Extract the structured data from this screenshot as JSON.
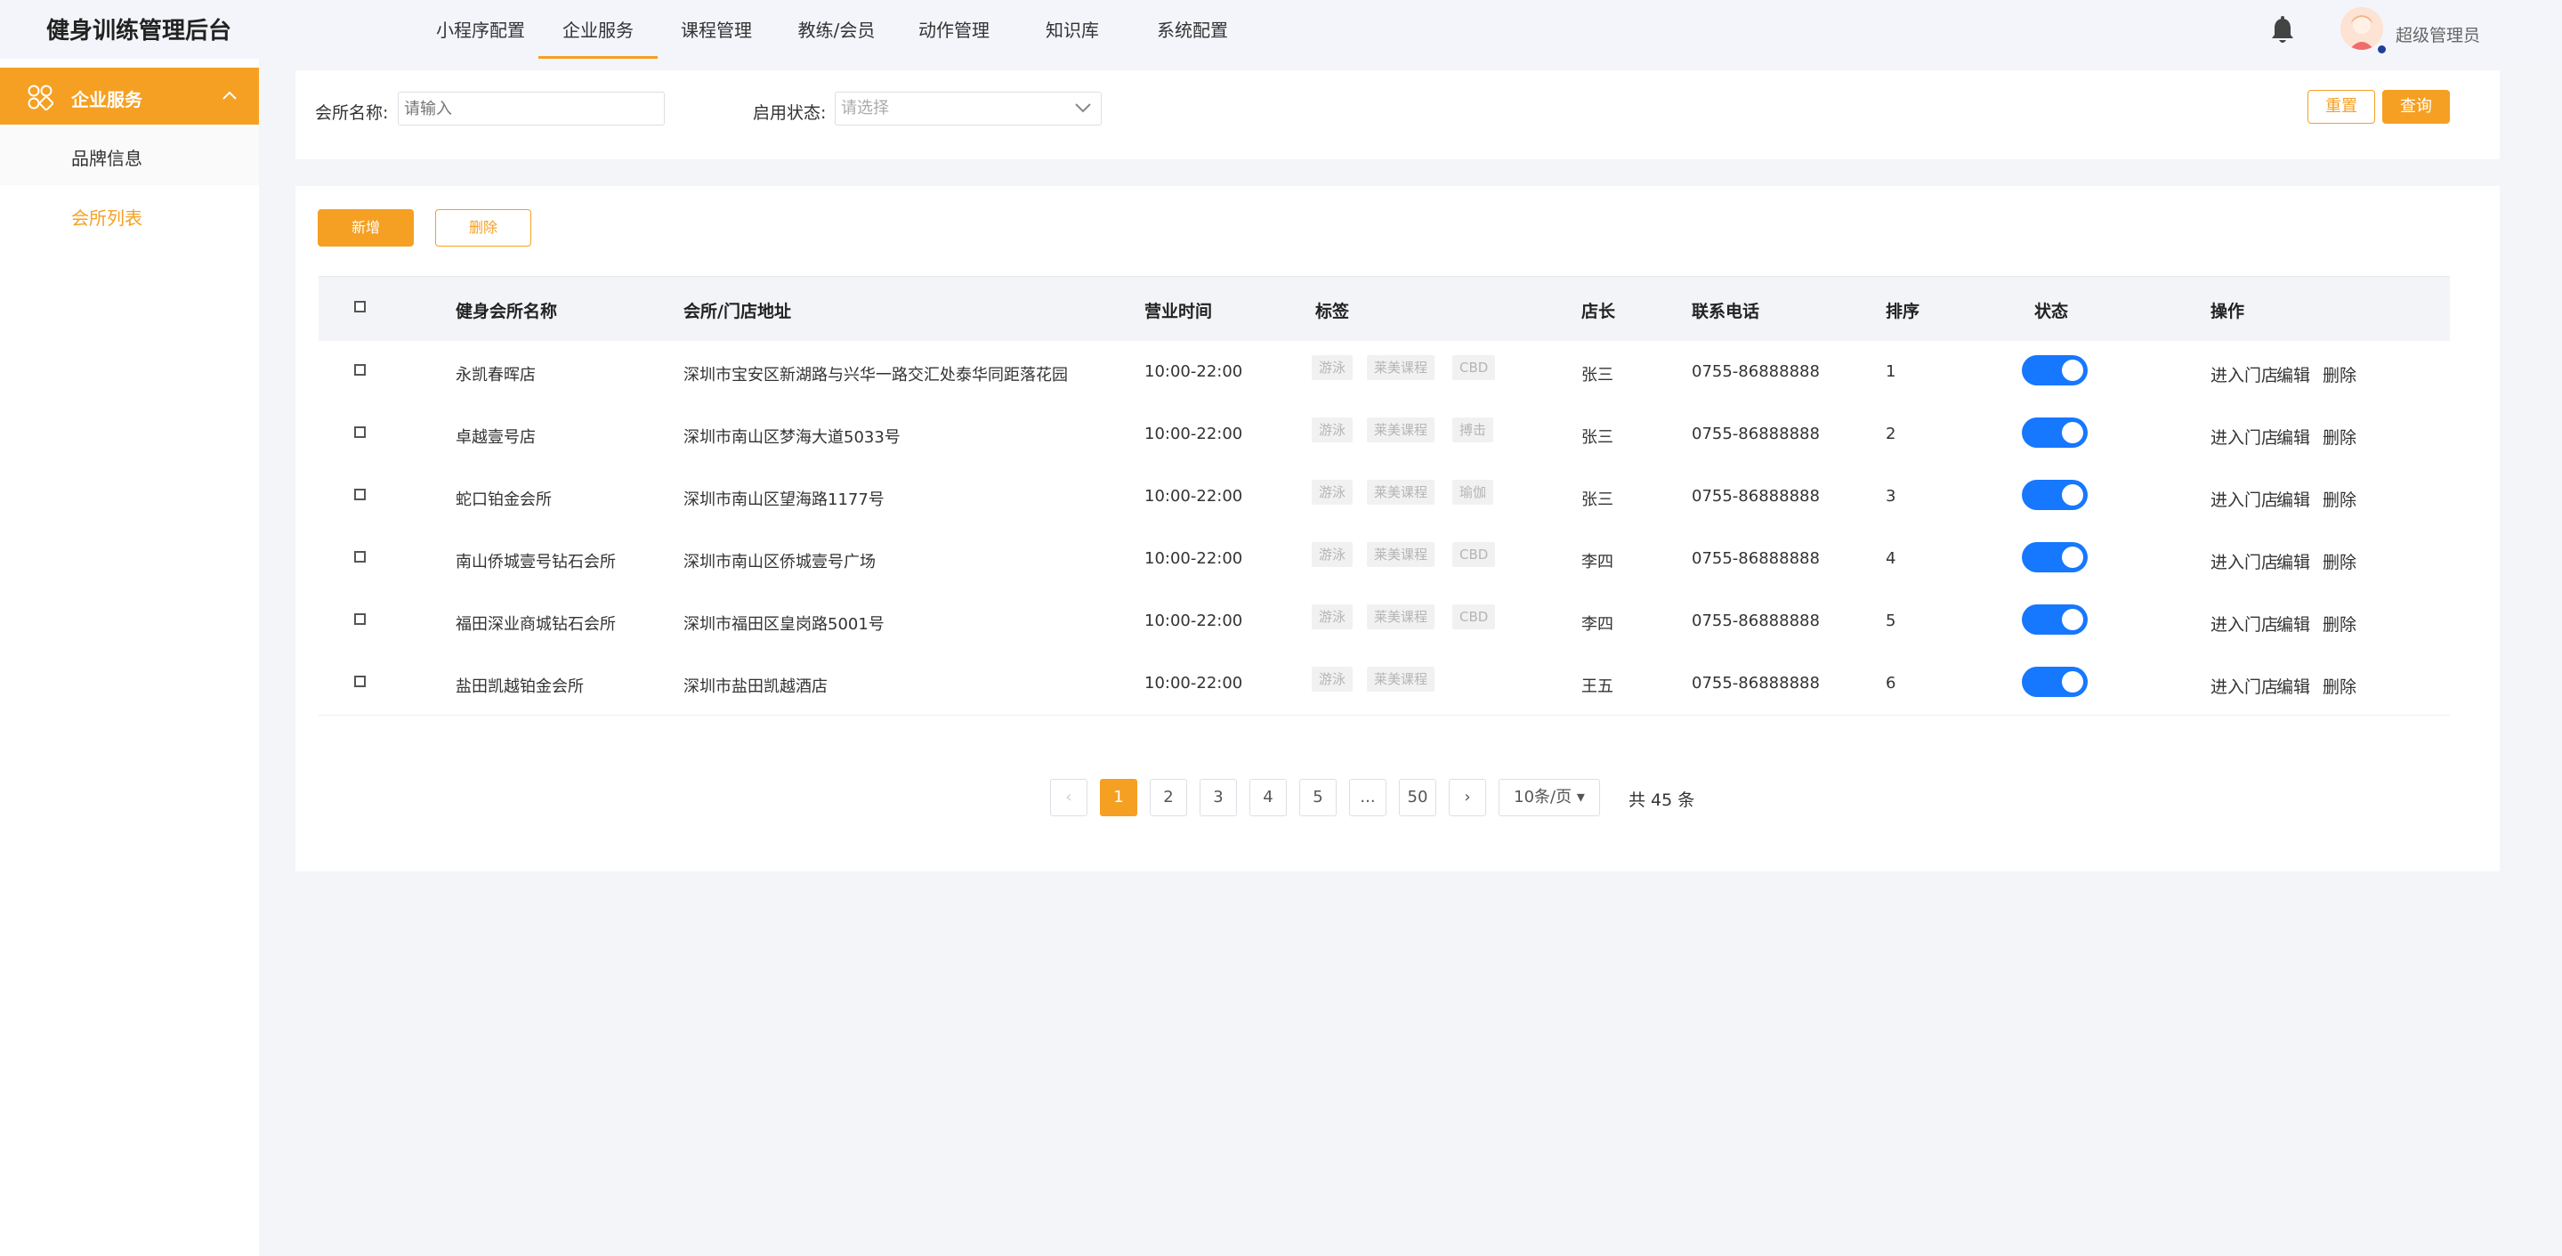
{
  "app": {
    "title": "健身训练管理后台"
  },
  "topnav": {
    "items": [
      {
        "label": "小程序配置"
      },
      {
        "label": "企业服务"
      },
      {
        "label": "课程管理"
      },
      {
        "label": "教练/会员"
      },
      {
        "label": "动作管理"
      },
      {
        "label": "知识库"
      },
      {
        "label": "系统配置"
      }
    ],
    "active": "企业服务"
  },
  "user": {
    "name": "超级管理员",
    "icons": [
      "bell-icon",
      "avatar"
    ]
  },
  "sidebar": {
    "group": {
      "label": "企业服务",
      "icon": "grid-icon",
      "expanded": true
    },
    "items": [
      {
        "label": "品牌信息"
      },
      {
        "label": "会所列表"
      }
    ],
    "active": "会所列表"
  },
  "filter": {
    "name_label": "会所名称:",
    "name_placeholder": "请输入",
    "status_label": "启用状态:",
    "status_placeholder": "请选择",
    "reset_label": "重置",
    "search_label": "查询"
  },
  "toolbar": {
    "add_label": "新增",
    "delete_label": "删除"
  },
  "table": {
    "headers": [
      "健身会所名称",
      "会所/门店地址",
      "营业时间",
      "标签",
      "店长",
      "联系电话",
      "排序",
      "状态",
      "操作"
    ],
    "rows": [
      {
        "name": "永凯春晖店",
        "address": "深圳市宝安区新湖路与兴华一路交汇处泰华同距落花园",
        "hours": "10:00-22:00",
        "tags": [
          "游泳",
          "莱美课程",
          "CBD"
        ],
        "manager": "张三",
        "phone": "0755-86888888",
        "order": "1",
        "enabled": true
      },
      {
        "name": "卓越壹号店",
        "address": "深圳市南山区梦海大道5033号",
        "hours": "10:00-22:00",
        "tags": [
          "游泳",
          "莱美课程",
          "搏击"
        ],
        "manager": "张三",
        "phone": "0755-86888888",
        "order": "2",
        "enabled": true
      },
      {
        "name": "蛇口铂金会所",
        "address": "深圳市南山区望海路1177号",
        "hours": "10:00-22:00",
        "tags": [
          "游泳",
          "莱美课程",
          "瑜伽"
        ],
        "manager": "张三",
        "phone": "0755-86888888",
        "order": "3",
        "enabled": true
      },
      {
        "name": "南山侨城壹号钻石会所",
        "address": "深圳市南山区侨城壹号广场",
        "hours": "10:00-22:00",
        "tags": [
          "游泳",
          "莱美课程",
          "CBD"
        ],
        "manager": "李四",
        "phone": "0755-86888888",
        "order": "4",
        "enabled": true
      },
      {
        "name": "福田深业商城钻石会所",
        "address": "深圳市福田区皇岗路5001号",
        "hours": "10:00-22:00",
        "tags": [
          "游泳",
          "莱美课程",
          "CBD"
        ],
        "manager": "李四",
        "phone": "0755-86888888",
        "order": "5",
        "enabled": true
      },
      {
        "name": "盐田凯越铂金会所",
        "address": "深圳市盐田凯越酒店",
        "hours": "10:00-22:00",
        "tags": [
          "游泳",
          "莱美课程"
        ],
        "manager": "王五",
        "phone": "0755-86888888",
        "order": "6",
        "enabled": true
      }
    ],
    "row_actions": [
      "进入门店",
      "编辑",
      "删除"
    ]
  },
  "pagination": {
    "prev": "‹",
    "pages": [
      "1",
      "2",
      "3",
      "4",
      "5",
      "...",
      "50"
    ],
    "current": "1",
    "next": "›",
    "page_size": "10条/页 ▾",
    "total_text": "共 45 条"
  },
  "colors": {
    "accent": "#f5a023",
    "switch_on": "#1677ff",
    "background": "#f4f5f9"
  }
}
